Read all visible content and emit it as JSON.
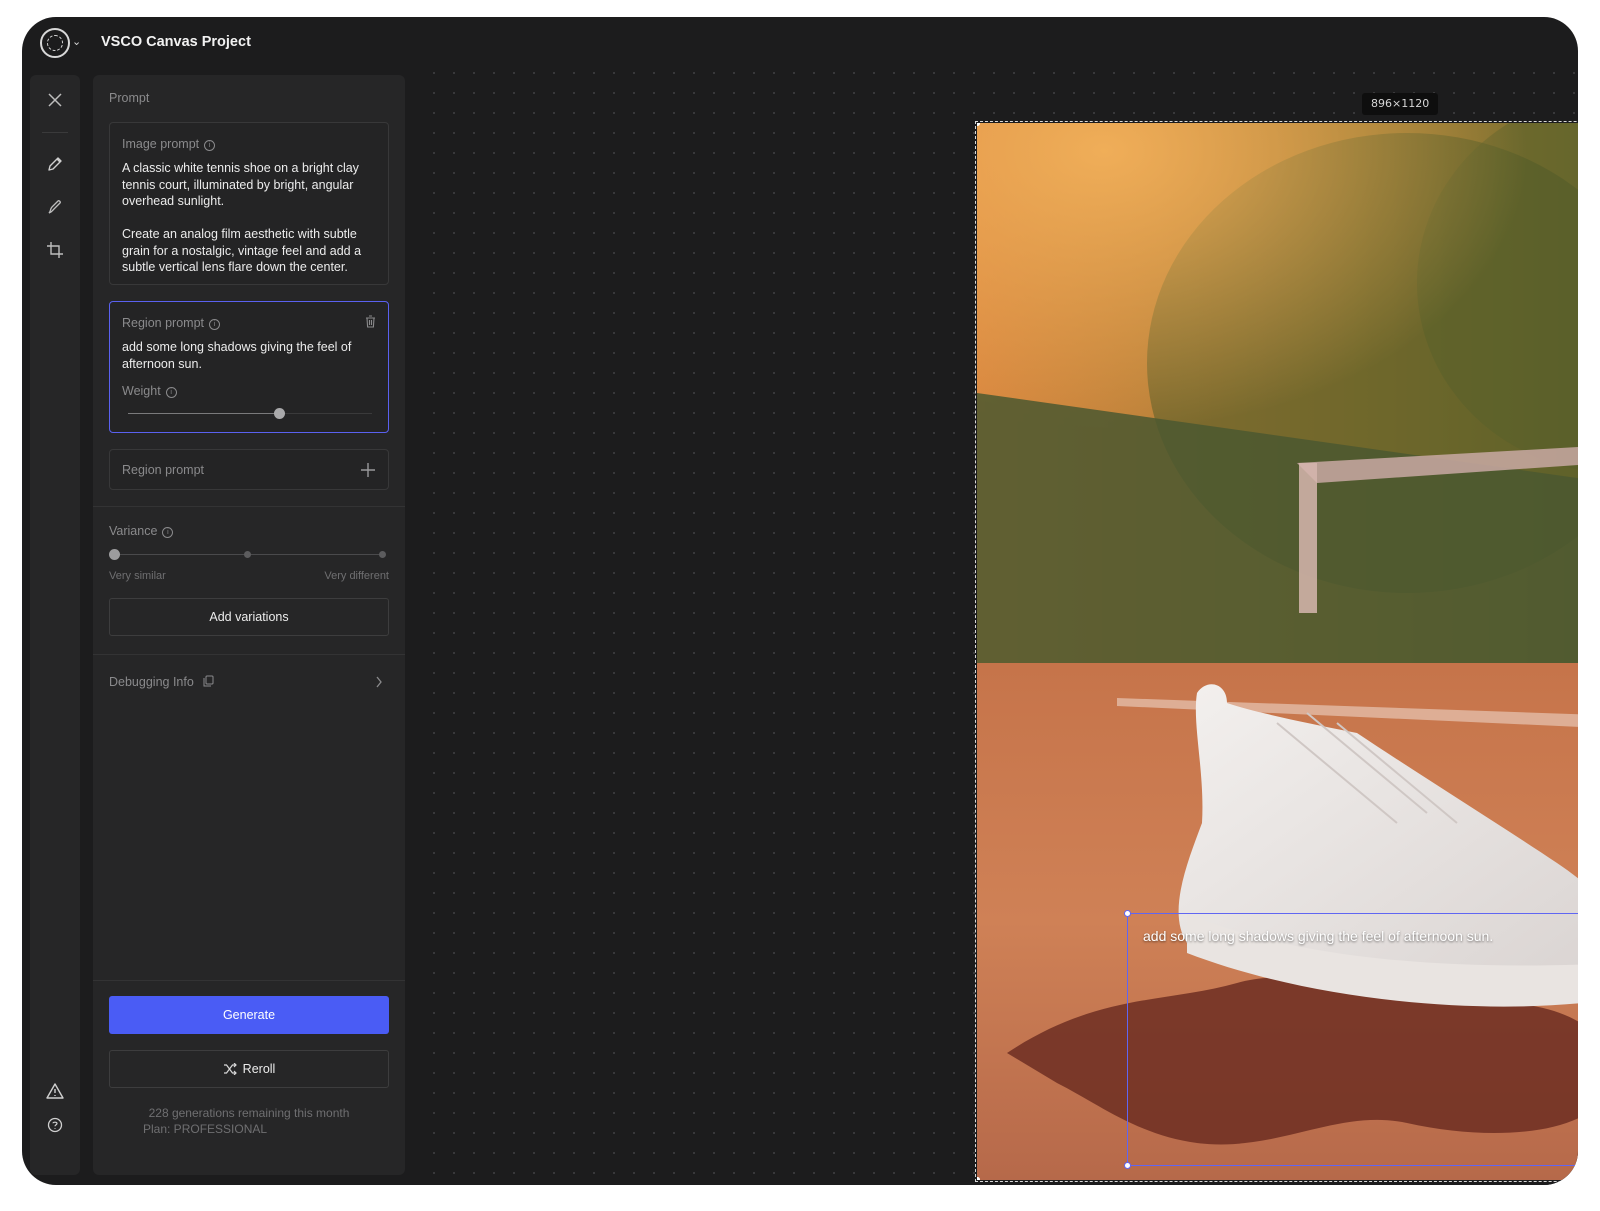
{
  "app": {
    "title": "VSCO Canvas Project"
  },
  "prompt_panel": {
    "section_label": "Prompt",
    "image_prompt": {
      "label": "Image prompt",
      "text": "A classic white tennis shoe on a bright clay tennis court, illuminated by bright, angular overhead sunlight.\n\nCreate an analog film aesthetic with subtle grain for a nostalgic, vintage feel and add a subtle vertical lens flare down the center."
    },
    "region_prompt": {
      "label": "Region prompt",
      "text": "add some long shadows giving the feel of afternoon sun.",
      "weight_label": "Weight",
      "weight_value": 0.62
    },
    "add_region": {
      "label": "Region prompt"
    },
    "variance": {
      "label": "Variance",
      "min_label": "Very similar",
      "max_label": "Very different",
      "value": 0
    },
    "add_variations_label": "Add variations",
    "debugging_label": "Debugging Info",
    "generate_label": "Generate",
    "reroll_label": "Reroll",
    "usage_line1": "228 generations remaining this month",
    "usage_line2": "Plan: PROFESSIONAL"
  },
  "canvas": {
    "dimensions": "896×1120",
    "region_overlay_text": "add some long shadows giving the feel of afternoon sun."
  },
  "toolbar_icons": [
    "close-icon",
    "pencil-icon",
    "brush-icon",
    "crop-icon",
    "warning-icon",
    "help-icon"
  ],
  "colors": {
    "accent": "#4a5cf5",
    "region_outline": "#6066f2",
    "annotation_arrow": "#e8361b"
  }
}
